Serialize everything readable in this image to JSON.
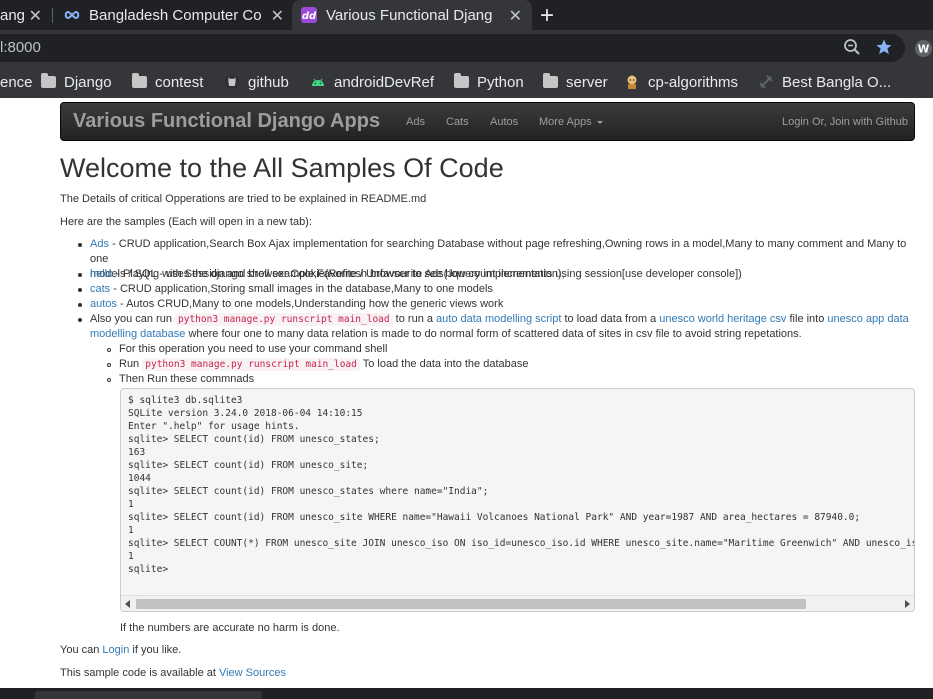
{
  "tabs": [
    {
      "title": "ang",
      "close": "✕",
      "active": false
    },
    {
      "title": "Bangladesh Computer Co",
      "close": "✕",
      "active": false
    },
    {
      "title": "Various Functional Djang",
      "close": "✕",
      "active": true
    }
  ],
  "new_tab": "+",
  "address": {
    "url": "l:8000"
  },
  "bookmarks": [
    {
      "label": "ence",
      "icon": "none"
    },
    {
      "label": "Django",
      "icon": "folder-icon"
    },
    {
      "label": "contest",
      "icon": "folder-icon"
    },
    {
      "label": "github",
      "icon": "github-icon"
    },
    {
      "label": "androidDevRef",
      "icon": "android-icon"
    },
    {
      "label": "Python",
      "icon": "folder-icon"
    },
    {
      "label": "server",
      "icon": "folder-icon"
    },
    {
      "label": "cp-algorithms",
      "icon": "cp-algorithms-icon"
    },
    {
      "label": "Best Bangla O...",
      "icon": "link-icon"
    }
  ],
  "navbar": {
    "brand": "Various Functional Django Apps",
    "links": [
      "Ads",
      "Cats",
      "Autos",
      "More Apps"
    ],
    "login": "Login Or, Join with Github"
  },
  "main": {
    "heading": "Welcome to the All Samples Of Code",
    "intro": "The Details of critical Opperations are tried to be explained in README.md",
    "samples_intro": "Here are the samples (Each will open in a new tab):",
    "items": {
      "ads_link": "Ads",
      "ads_text_1": " - CRUD application,Search Box Ajax implementation for searching Database without page refreshing,Owning rows in a model,Many to many comment and Many to one",
      "ads_text_2": "models / SQL - uses the django shell example,Favorite / Unfavourite Ads(Jquery implementation),",
      "hello_link": "hello",
      "hello_text": " - Playing with Session and browser Cookie(Refresh browser to see how count increments using session[use developer console])",
      "cats_link": "cats",
      "cats_text": " - CRUD application,Storing small images in the database,Many to one models",
      "autos_link": "autos",
      "autos_text": " - Autos CRUD,Many to one models,Understanding how the generic views work",
      "also_prefix": "Also you can run ",
      "also_code": "python3 manage.py runscript main_load",
      "also_mid1": " to run a ",
      "also_link1": "auto data modelling script",
      "also_mid2": " to load data from a ",
      "also_link2": "unesco world heritage csv",
      "also_mid3": " file into ",
      "also_link3a": "unesco app data",
      "also_link3b": "modelling database",
      "also_tail": " where four one to many data relation is made to do normal form of scattered data of sites in csv file to avoid string repetations."
    },
    "subitems": {
      "shell": "For this operation you need to use your command shell",
      "run_prefix": "Run ",
      "run_code": "python3 manage.py runscript main_load",
      "run_suffix": " To load the data into the database",
      "then": "Then Run these commnads"
    },
    "code_lines": [
      "$ sqlite3 db.sqlite3",
      "SQLite version 3.24.0 2018-06-04 14:10:15",
      "Enter \".help\" for usage hints.",
      "sqlite> SELECT count(id) FROM unesco_states;",
      "163",
      "sqlite> SELECT count(id) FROM unesco_site;",
      "1044",
      "sqlite> SELECT count(id) FROM unesco_states where name=\"India\";",
      "1",
      "sqlite> SELECT count(id) FROM unesco_site WHERE name=\"Hawaii Volcanoes National Park\" AND year=1987 AND area_hectares = 87940.0;",
      "1",
      "sqlite> SELECT COUNT(*) FROM unesco_site JOIN unesco_iso ON iso_id=unesco_iso.id WHERE unesco_site.name=\"Maritime Greenwich\" AND unesco_iso.name=\"gb\";",
      "1",
      "sqlite>"
    ],
    "after_code": "If the numbers are accurate no harm is done.",
    "login_prefix": "You can ",
    "login_link": "Login",
    "login_suffix": " if you like.",
    "source_prefix": "This sample code is available at ",
    "source_link": "View Sources"
  }
}
